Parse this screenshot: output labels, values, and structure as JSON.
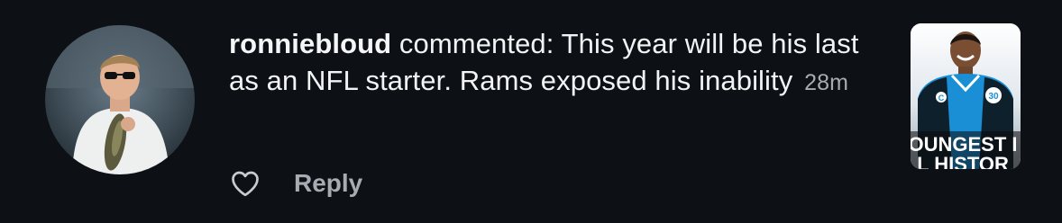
{
  "comment": {
    "username": "ronniebloud",
    "verb": "commented:",
    "text": "This year will be his last as an NFL starter. Rams exposed his inability",
    "time": "28m"
  },
  "actions": {
    "reply_label": "Reply",
    "like_icon": "heart-outline-icon"
  },
  "avatar": {
    "description_icon": "user-avatar"
  },
  "thumbnail": {
    "headline_line1": "OUNGEST I",
    "headline_line2": "L HISTOR",
    "jersey_number": "30"
  },
  "colors": {
    "background": "#0d1014",
    "text_primary": "#f2f3f5",
    "text_secondary": "#a7acb3",
    "thumbnail_blue": "#1a8fd6"
  }
}
